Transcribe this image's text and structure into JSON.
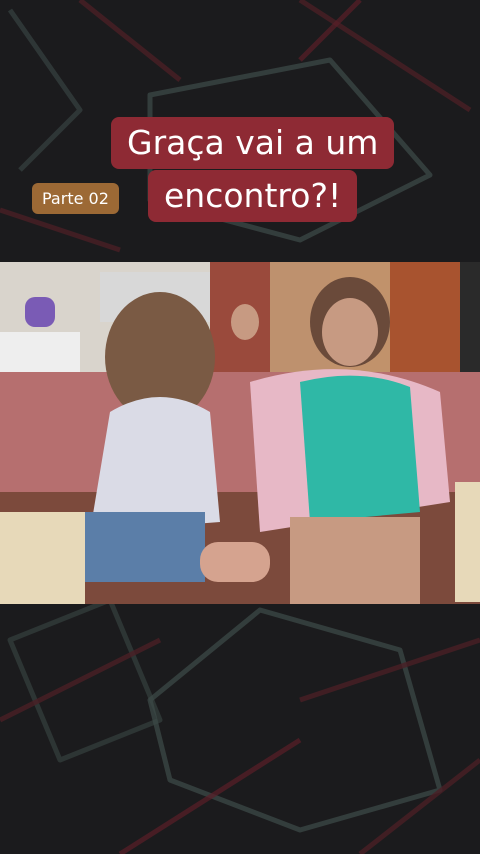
{
  "overlay": {
    "title_line1": "Graça vai a um",
    "title_line2": "encontro?!",
    "part_badge": "Parte 02"
  },
  "colors": {
    "background": "#1b1b1d",
    "title_bg": "#8e2a34",
    "badge_bg": "#9c6935",
    "text": "#ffffff"
  },
  "video": {
    "scene": "two women sitting on a sofa in a kitchen set"
  }
}
